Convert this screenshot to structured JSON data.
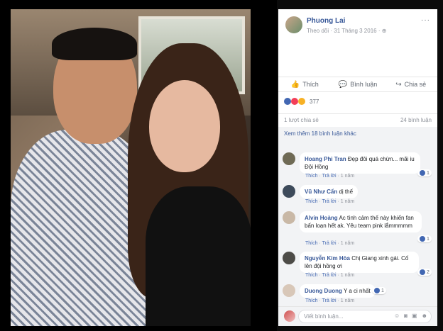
{
  "post": {
    "author": "Phuong Lai",
    "meta": "Theo dõi · 31 Tháng 3 2016 · ",
    "privacy_icon": "globe-icon",
    "more_label": "···"
  },
  "actions": {
    "like": "Thích",
    "comment": "Bình luận",
    "share": "Chia sẻ"
  },
  "reactions": {
    "types": [
      "like",
      "love",
      "haha"
    ],
    "count": "377"
  },
  "stats": {
    "shares": "1 lượt chia sẻ",
    "comments": "24 bình luận"
  },
  "comments_section": {
    "view_more": "Xem thêm 18 bình luận khác",
    "items": [
      {
        "author": "Hoang Phi Tran",
        "text": "Đẹp đôi quá chừn... mãi iu Đội Hồng",
        "like": "Thích",
        "reply": "Trả lời",
        "time": "1 năm",
        "reaction_count": "1",
        "avatar_color": "#6f6a55"
      },
      {
        "author": "Vũ Như Cẩn",
        "text": "dị thế",
        "like": "Thích",
        "reply": "Trả lời",
        "time": "1 năm",
        "reaction_count": "",
        "avatar_color": "#3d4a5a"
      },
      {
        "author": "Alvin Hoàng",
        "text": "Ac tình cảm thế này khiến fan bấn loạn hết ak. Yêu team pink lắmmmmm",
        "like": "Thích",
        "reply": "Trả lời",
        "time": "1 năm",
        "reaction_count": "1",
        "avatar_color": "#c9b8a6"
      },
      {
        "author": "Nguyễn Kim Hòa",
        "text": "Chị Giang xinh gái. Cố lên đội hồng ơi",
        "like": "Thích",
        "reply": "Trả lời",
        "time": "1 năm",
        "reaction_count": "2",
        "avatar_color": "#4d4b47"
      },
      {
        "author": "Duong Duong",
        "text": "Y a ci nhất",
        "like": "Thích",
        "reply": "Trả lời",
        "time": "1 năm",
        "reaction_count": "1",
        "avatar_color": "#d8c7b8"
      }
    ]
  },
  "compose": {
    "placeholder": "Viết bình luận...",
    "icons": [
      "emoji-icon",
      "camera-icon",
      "gif-icon",
      "sticker-icon"
    ]
  },
  "colors": {
    "link_blue": "#385898",
    "like_blue": "#4267b2",
    "love_red": "#f33e58",
    "haha_yellow": "#f7b125"
  }
}
